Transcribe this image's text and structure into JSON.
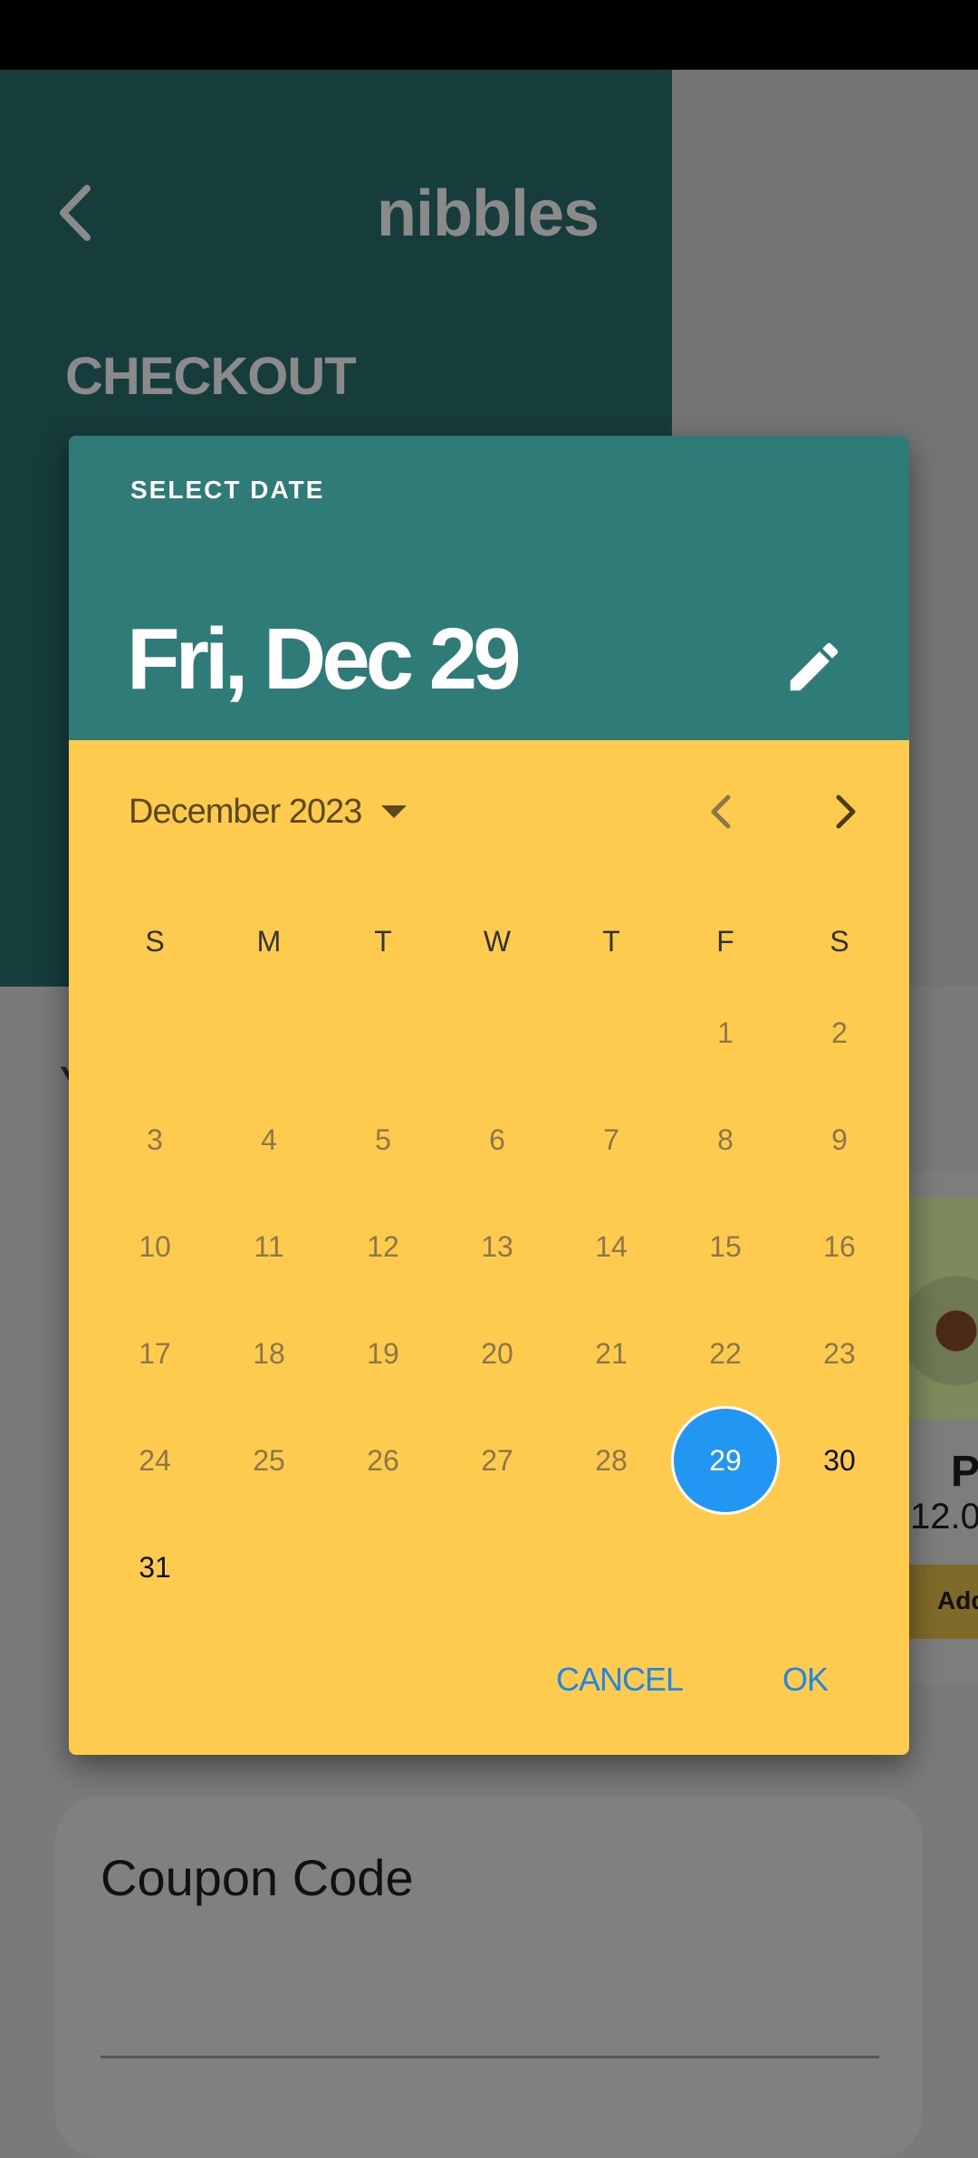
{
  "app": {
    "logo": "nibbles",
    "page_title": "CHECKOUT",
    "side_text": "Y"
  },
  "product": {
    "name": "P",
    "price": "12.0",
    "add_label": "Add"
  },
  "coupon": {
    "title": "Coupon Code",
    "value": ""
  },
  "dialog": {
    "caption": "SELECT DATE",
    "selected_date": "Fri, Dec 29",
    "month_label": "December 2023",
    "weekdays": [
      "S",
      "M",
      "T",
      "W",
      "T",
      "F",
      "S"
    ],
    "first_weekday_index": 5,
    "days": [
      "1",
      "2",
      "3",
      "4",
      "5",
      "6",
      "7",
      "8",
      "9",
      "10",
      "11",
      "12",
      "13",
      "14",
      "15",
      "16",
      "17",
      "18",
      "19",
      "20",
      "21",
      "22",
      "23",
      "24",
      "25",
      "26",
      "27",
      "28",
      "29",
      "30",
      "31"
    ],
    "selected_day": "29",
    "enabled_days": [
      "29",
      "30",
      "31"
    ],
    "cancel_label": "CANCEL",
    "ok_label": "OK"
  },
  "colors": {
    "header_dark": "#173c3c",
    "dialog_header": "#2f7b78",
    "dialog_body": "#ffcb4f",
    "accent": "#2196f3",
    "action_text": "#1e88e5"
  },
  "icons": {
    "back": "chevron-left-icon",
    "edit": "pencil-icon",
    "month_dropdown": "caret-down-icon",
    "prev_month": "chevron-left-icon",
    "next_month": "chevron-right-icon"
  }
}
